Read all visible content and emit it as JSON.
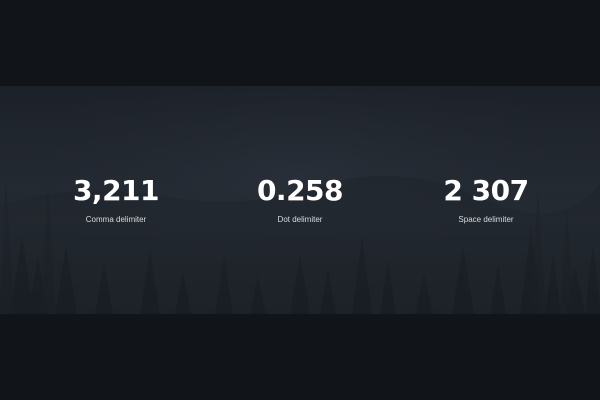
{
  "counters": [
    {
      "value": "3,211",
      "label": "Comma delimiter"
    },
    {
      "value": "0.258",
      "label": "Dot delimiter"
    },
    {
      "value": "2 307",
      "label": "Space delimiter"
    }
  ],
  "background": {
    "image": "misty-forest",
    "overlay_color": "#1c2129",
    "page_color": "#111419"
  }
}
